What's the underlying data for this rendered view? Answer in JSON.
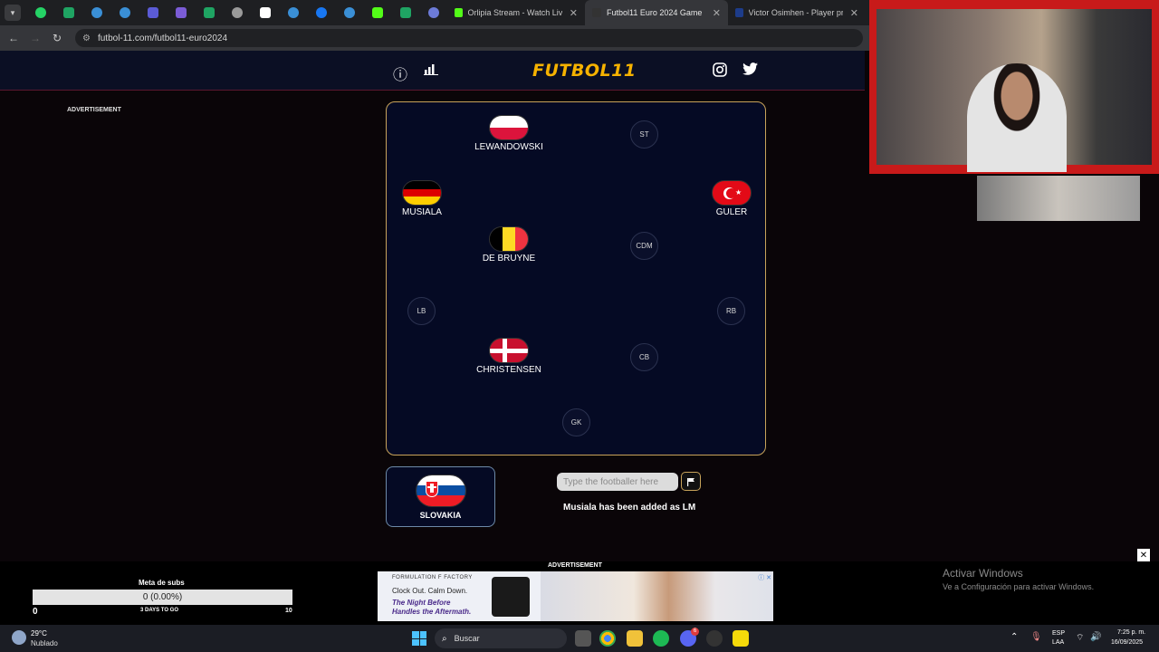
{
  "browser": {
    "tabs": [
      {
        "title": "Orlipia Stream - Watch Live on",
        "active": false
      },
      {
        "title": "Futbol11 Euro 2024 Game",
        "active": true
      },
      {
        "title": "Victor Osimhen - Player profile",
        "active": false
      }
    ],
    "url": "futbol-11.com/futbol11-euro2024"
  },
  "site": {
    "logo": "FUTBOL11",
    "ad_label": "ADVERTISEMENT"
  },
  "pitch": {
    "players": [
      {
        "name": "LEWANDOWSKI",
        "country": "Poland"
      },
      {
        "name": "MUSIALA",
        "country": "Germany"
      },
      {
        "name": "GULER",
        "country": "Turkey"
      },
      {
        "name": "DE BRUYNE",
        "country": "Belgium"
      },
      {
        "name": "CHRISTENSEN",
        "country": "Denmark"
      }
    ],
    "slots": [
      "ST",
      "CDM",
      "LB",
      "RB",
      "CB",
      "GK"
    ]
  },
  "guess": {
    "country": "SLOVAKIA",
    "placeholder": "Type the footballer here",
    "status": "Musiala has been added as LM"
  },
  "bottom_ad": {
    "label": "ADVERTISEMENT",
    "brand": "FORMULATION F FACTORY",
    "line1": "Clock Out. Calm Down.",
    "line2": "The Night Before",
    "line3": "Handles the Aftermath."
  },
  "subs_goal": {
    "title": "Meta de subs",
    "progress_text": "0 (0.00%)",
    "progress_fraction": 0.0,
    "min": "0",
    "days_left": "3 DAYS TO GO",
    "max": "10"
  },
  "windows_notice": {
    "title": "Activar Windows",
    "subtitle": "Ve a Configuración para activar Windows."
  },
  "taskbar": {
    "weather_temp": "29°C",
    "weather_desc": "Nublado",
    "search_placeholder": "Buscar",
    "lang": "ESP",
    "layout": "LAA",
    "time": "7:25 p. m.",
    "date": "16/09/2025",
    "discord_badge": "6"
  },
  "colors": {
    "accent_gold": "#f6b200",
    "pitch_bg": "#050a24",
    "pitch_border": "#c8a35a",
    "webcam_frame": "#c81a1a"
  }
}
